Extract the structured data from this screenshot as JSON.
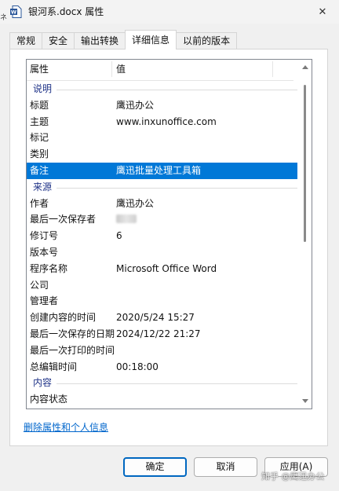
{
  "window": {
    "title": "银河系.docx 属性",
    "close_glyph": "✕",
    "left_edge_glyph": "ネ"
  },
  "tabs": [
    {
      "label": "常规",
      "active": false
    },
    {
      "label": "安全",
      "active": false
    },
    {
      "label": "输出转换",
      "active": false
    },
    {
      "label": "详细信息",
      "active": true
    },
    {
      "label": "以前的版本",
      "active": false
    }
  ],
  "list": {
    "headers": {
      "property": "属性",
      "value": "值"
    },
    "rows": [
      {
        "type": "group",
        "key": "说明"
      },
      {
        "type": "item",
        "key": "标题",
        "value": "鹰迅办公"
      },
      {
        "type": "item",
        "key": "主题",
        "value": "www.inxunoffice.com"
      },
      {
        "type": "item",
        "key": "标记",
        "value": ""
      },
      {
        "type": "item",
        "key": "类别",
        "value": ""
      },
      {
        "type": "item",
        "key": "备注",
        "value": "鹰迅批量处理工具箱",
        "selected": true
      },
      {
        "type": "group",
        "key": "来源"
      },
      {
        "type": "item",
        "key": "作者",
        "value": "鹰迅办公"
      },
      {
        "type": "item",
        "key": "最后一次保存者",
        "value": "",
        "redacted": true
      },
      {
        "type": "item",
        "key": "修订号",
        "value": "6"
      },
      {
        "type": "item",
        "key": "版本号",
        "value": ""
      },
      {
        "type": "item",
        "key": "程序名称",
        "value": "Microsoft Office Word"
      },
      {
        "type": "item",
        "key": "公司",
        "value": ""
      },
      {
        "type": "item",
        "key": "管理者",
        "value": ""
      },
      {
        "type": "item",
        "key": "创建内容的时间",
        "value": "2020/5/24 15:27"
      },
      {
        "type": "item",
        "key": "最后一次保存的日期",
        "value": "2024/12/22 21:27"
      },
      {
        "type": "item",
        "key": "最后一次打印的时间",
        "value": ""
      },
      {
        "type": "item",
        "key": "总编辑时间",
        "value": "00:18:00"
      },
      {
        "type": "group",
        "key": "内容"
      },
      {
        "type": "item",
        "key": "内容状态",
        "value": ""
      }
    ]
  },
  "remove_link": "删除属性和个人信息",
  "buttons": {
    "ok": "确定",
    "cancel": "取消",
    "apply": "应用(A)"
  },
  "watermark": "知乎 @鹰迅办公",
  "colors": {
    "selection": "#0078d7",
    "group_text": "#1e3287",
    "link": "#0066cc",
    "default_button_border": "#0067c0"
  },
  "icons": {
    "title": "word-document-icon",
    "close": "close-icon"
  }
}
